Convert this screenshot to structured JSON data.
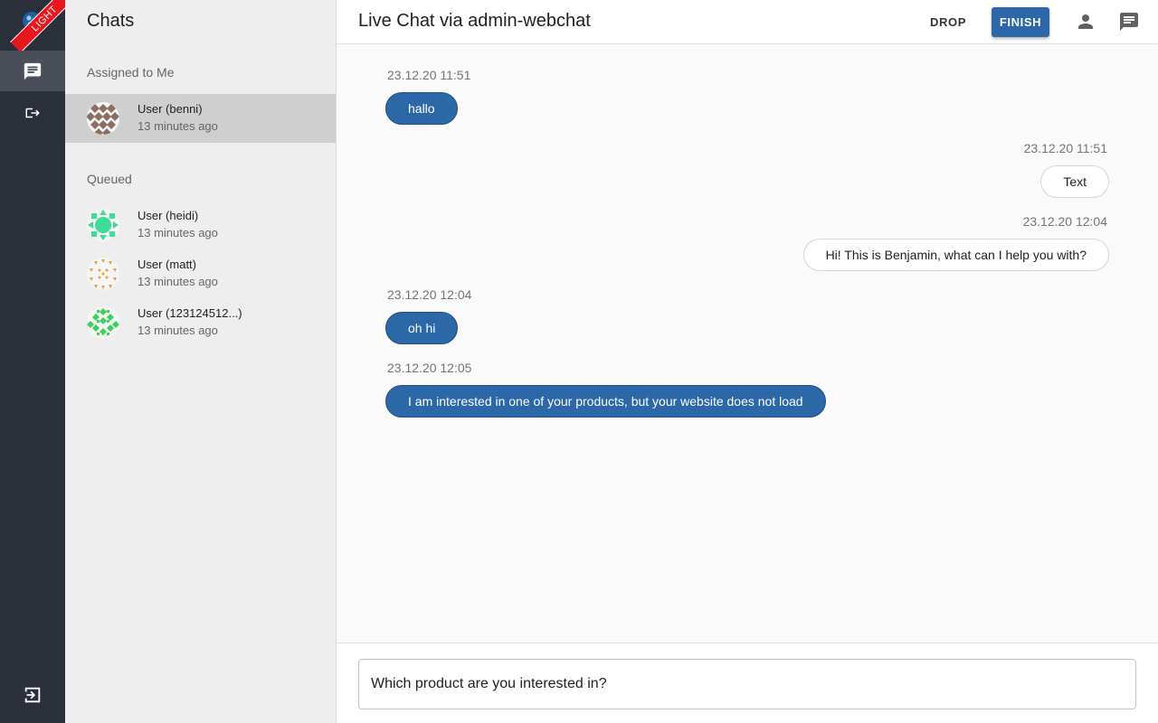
{
  "rail": {
    "ribbon_label": "LIGHT",
    "items": [
      {
        "name": "chats",
        "icon": "chat-icon",
        "active": true
      },
      {
        "name": "forward",
        "icon": "forward-icon",
        "active": false
      }
    ],
    "bottom_icon": "logout-icon"
  },
  "chat_list": {
    "title": "Chats",
    "sections": [
      {
        "title": "Assigned to Me",
        "items": [
          {
            "name": "User (benni)",
            "time": "13 minutes ago",
            "selected": true,
            "avatar_color": "#8d6e63"
          }
        ]
      },
      {
        "title": "Queued",
        "items": [
          {
            "name": "User (heidi)",
            "time": "13 minutes ago",
            "selected": false,
            "avatar_color": "#3ddc97"
          },
          {
            "name": "User (matt)",
            "time": "13 minutes ago",
            "selected": false,
            "avatar_color": "#e6a23c"
          },
          {
            "name": "User (123124512...)",
            "time": "13 minutes ago",
            "selected": false,
            "avatar_color": "#3fcf5a"
          }
        ]
      }
    ]
  },
  "header": {
    "title": "Live Chat via admin-webchat",
    "drop_label": "DROP",
    "finish_label": "FINISH",
    "icons": [
      "person-icon",
      "chat-icon"
    ]
  },
  "messages": [
    {
      "timestamp": "23.12.20 11:51",
      "text": "hallo",
      "direction": "incoming"
    },
    {
      "timestamp": "23.12.20 11:51",
      "text": "Text",
      "direction": "outgoing"
    },
    {
      "timestamp": "23.12.20 12:04",
      "text": "Hi! This is Benjamin, what can I help you with?",
      "direction": "outgoing"
    },
    {
      "timestamp": "23.12.20 12:04",
      "text": "oh hi",
      "direction": "incoming"
    },
    {
      "timestamp": "23.12.20 12:05",
      "text": "I am interested in one of your products, but your website does not load",
      "direction": "incoming"
    }
  ],
  "composer": {
    "value": "Which product are you interested in?"
  },
  "colors": {
    "accent": "#2c67a8",
    "rail": "#2b2f3a",
    "ribbon": "#e8171d"
  }
}
